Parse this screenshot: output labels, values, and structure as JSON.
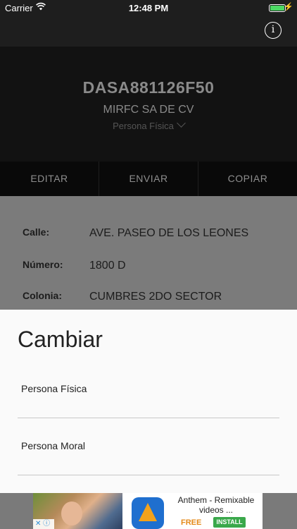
{
  "status_bar": {
    "carrier": "Carrier",
    "time": "12:48 PM",
    "battery_level": 1.0
  },
  "nav": {
    "info_icon_glyph": "i"
  },
  "header": {
    "rfc": "DASA881126F50",
    "company": "MIRFC SA DE CV",
    "tipo": "Persona Física"
  },
  "actions": {
    "edit": "EDITAR",
    "send": "ENVIAR",
    "copy": "COPIAR"
  },
  "details": [
    {
      "label": "Calle:",
      "value": "AVE. PASEO DE LOS LEONES"
    },
    {
      "label": "Número:",
      "value": "1800 D"
    },
    {
      "label": "Colonia:",
      "value": "CUMBRES 2DO SECTOR"
    }
  ],
  "sheet": {
    "title": "Cambiar",
    "options": [
      "Persona Física",
      "Persona Moral"
    ]
  },
  "ad": {
    "title": "Anthem - Remixable videos ...",
    "price": "FREE",
    "install": "INSTALL"
  },
  "colors": {
    "accent_battery": "#4cd964",
    "install_green": "#3aa84b",
    "free_orange": "#e48a1a"
  }
}
